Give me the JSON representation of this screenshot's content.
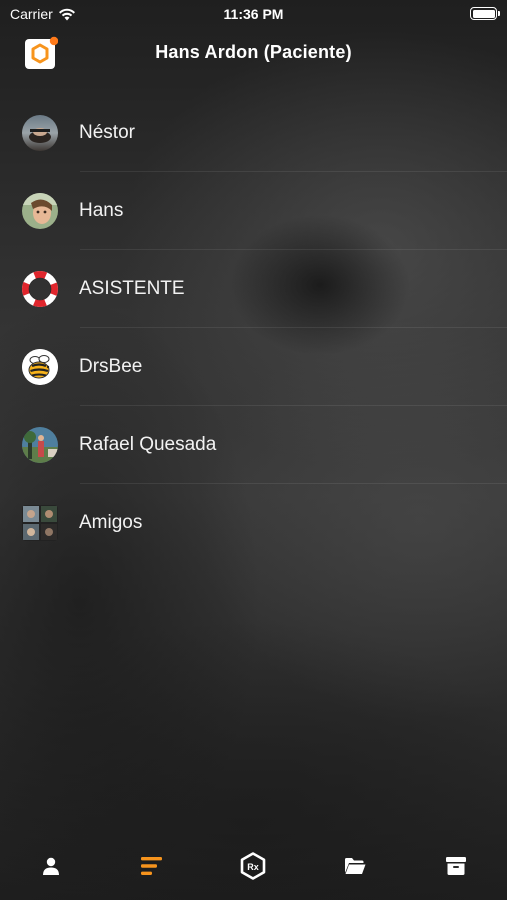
{
  "status_bar": {
    "carrier": "Carrier",
    "time": "11:36 PM"
  },
  "nav": {
    "title": "Hans Ardon (Paciente)",
    "logo_icon": "hexagon-app-logo-icon",
    "notification_dot_color": "#ff7a1a"
  },
  "conversations": [
    {
      "name": "Néstor",
      "avatar": "photo-avatar"
    },
    {
      "name": "Hans",
      "avatar": "photo-avatar"
    },
    {
      "name": "ASISTENTE",
      "avatar": "lifebuoy-icon"
    },
    {
      "name": "DrsBee",
      "avatar": "bee-icon"
    },
    {
      "name": "Rafael Quesada",
      "avatar": "photo-avatar"
    },
    {
      "name": "Amigos",
      "avatar": "group-collage-avatar"
    }
  ],
  "tab_bar": {
    "active_tab": "list",
    "accent_color": "#f7941d",
    "tabs": [
      {
        "id": "profile",
        "icon": "person-icon"
      },
      {
        "id": "list",
        "icon": "list-lines-icon"
      },
      {
        "id": "rx",
        "icon": "rx-hexagon-icon"
      },
      {
        "id": "folder",
        "icon": "folder-icon"
      },
      {
        "id": "archive",
        "icon": "archive-box-icon"
      }
    ]
  }
}
